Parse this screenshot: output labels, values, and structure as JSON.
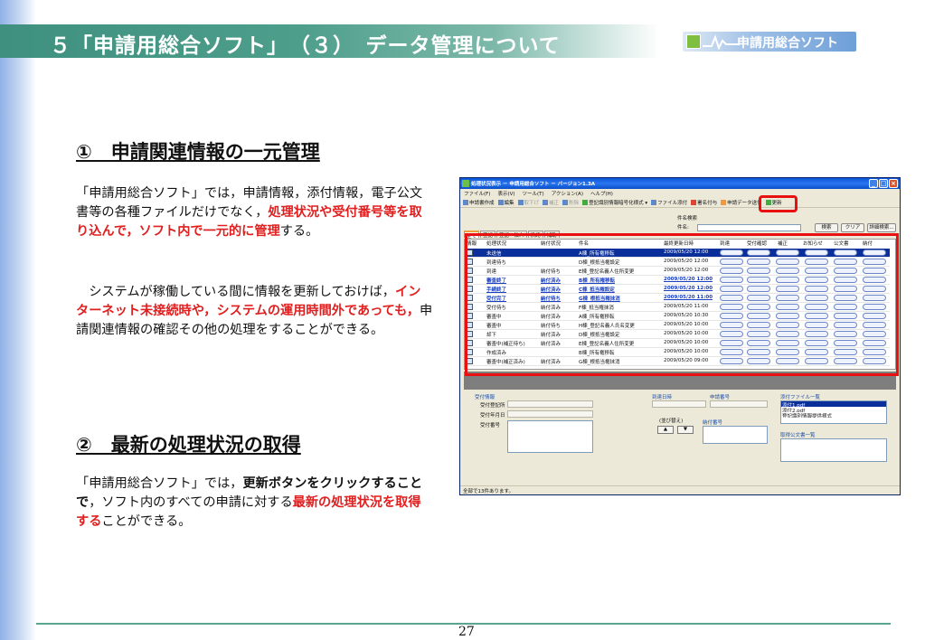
{
  "header": {
    "title": "５「申請用総合ソフト」　（３）　データ管理について",
    "logo_text": "申請用総合ソフト"
  },
  "section1": {
    "title": "①　申請関連情報の一元管理",
    "para1": [
      "「申請用総合ソフト」では，申請情報，添付情報，電子公文書等の各種ファイルだけでなく，",
      "処理状況や受付番号等を取り込んで，ソフト内で一元的に管理",
      "する。"
    ],
    "para2": [
      "　システムが稼働している間に情報を更新しておけば，",
      "インターネット未接続時や，システムの運用時間外であっても，",
      "申請関連情報の確認その他の処理をすることができる。"
    ]
  },
  "section2": {
    "title": "②　最新の処理状況の取得",
    "para": [
      "「申請用総合ソフト」では，",
      "更新ボタンをクリックすることで",
      "，ソフト内のすべての申請に対する",
      "最新の処理状況を取得する",
      "ことができる。"
    ]
  },
  "page_number": "27",
  "app": {
    "title": "処理状況表示 － 申請用総合ソフト － バージョン1.3A",
    "menu": [
      "ファイル(F)",
      "表示(V)",
      "ツール(T)",
      "アクション(A)",
      "ヘルプ(H)"
    ],
    "toolbar": [
      "申請書作成",
      "編集",
      "取下げ",
      "補正",
      "削除",
      "登記識別情報暗号化様式 ▾",
      "ファイル添付",
      "署名付与",
      "申請データ送信",
      "更新"
    ],
    "search_label": "件名検索",
    "search_field_label": "件名:",
    "search_buttons": [
      "検索",
      "クリア",
      "詳細検索..."
    ],
    "tabs": [
      "全て",
      "登記",
      "登記・法人",
      "供託",
      "補助"
    ],
    "columns": [
      "情報",
      "処理状況",
      "納付状況",
      "件名",
      "最終更新日時",
      "到達",
      "受付確認",
      "補正",
      "お知らせ",
      "公文書",
      "納付"
    ],
    "rows": [
      {
        "status": "未送信",
        "pay": "",
        "name": "A棟_所有権移転",
        "date": "2009/05/20 12:00",
        "bold": false,
        "sel": true
      },
      {
        "status": "到達待ち",
        "pay": "",
        "name": "D棟_根抵当権設定",
        "date": "2009/05/20 12:00",
        "bold": false,
        "sel": false
      },
      {
        "status": "到達",
        "pay": "納付待ち",
        "name": "E棟_登記名義人住所変更",
        "date": "2009/05/20 12:00",
        "bold": false,
        "sel": false
      },
      {
        "status": "審査終了",
        "pay": "納付済み",
        "name": "B棟_所有権移転",
        "date": "2009/05/20 12:00",
        "bold": true,
        "sel": false
      },
      {
        "status": "手続終了",
        "pay": "納付済み",
        "name": "C棟_抵当権設定",
        "date": "2009/05/20 12:00",
        "bold": true,
        "sel": false
      },
      {
        "status": "受付完了",
        "pay": "納付待ち",
        "name": "G棟_根抵当権抹消",
        "date": "2009/05/20 11:00",
        "bold": true,
        "sel": false
      },
      {
        "status": "受付待ち",
        "pay": "納付済み",
        "name": "F棟_抵当権抹消",
        "date": "2009/05/20 11:00",
        "bold": false,
        "sel": false
      },
      {
        "status": "審査中",
        "pay": "納付済み",
        "name": "A棟_所有権移転",
        "date": "2009/05/20 10:30",
        "bold": false,
        "sel": false
      },
      {
        "status": "審査中",
        "pay": "納付待ち",
        "name": "H棟_登記名義人氏名変更",
        "date": "2009/05/20 10:00",
        "bold": false,
        "sel": false
      },
      {
        "status": "却下",
        "pay": "納付済み",
        "name": "D棟_根抵当権設定",
        "date": "2009/05/20 10:00",
        "bold": false,
        "sel": false
      },
      {
        "status": "審査中(補正待ち)",
        "pay": "納付済み",
        "name": "E棟_登記名義人住所変更",
        "date": "2009/05/20 10:00",
        "bold": false,
        "sel": false
      },
      {
        "status": "作成済み",
        "pay": "",
        "name": "B棟_所有権移転",
        "date": "2009/05/20 10:00",
        "bold": false,
        "sel": false
      },
      {
        "status": "審査中(補正済み)",
        "pay": "納付済み",
        "name": "G棟_根抵当権抹消",
        "date": "2009/05/20 09:00",
        "bold": false,
        "sel": false
      }
    ],
    "pill_labels": [
      "到達",
      "受付確認",
      "補正",
      "お知らせ",
      "公文書",
      "納付"
    ],
    "lower": {
      "receipt_info": "受付情報",
      "receipt_office": "受付登記所",
      "receipt_date": "受付年月日",
      "receipt_number": "受付番号",
      "arrival_date": "到達日時",
      "application_number": "申請番号",
      "order_switch": "(並び替え)",
      "payment_number": "納付番号",
      "attachments_label": "添付ファイル一覧",
      "attachments": [
        "添付1.pdf",
        "添付2.pdf",
        "登記識別情報提供様式"
      ],
      "official_docs_label": "取得公文書一覧"
    },
    "status_text": "全部で13件あります。"
  }
}
